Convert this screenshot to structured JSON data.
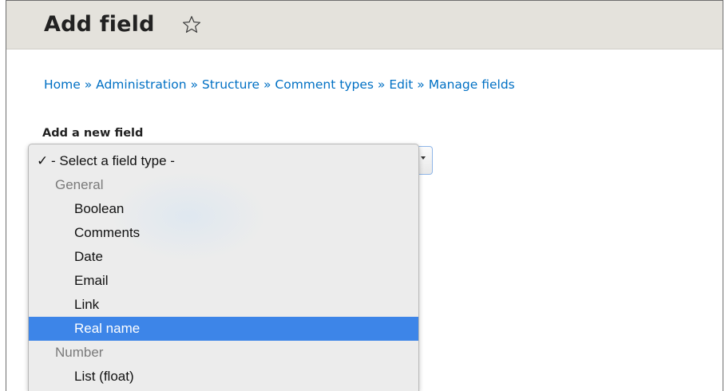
{
  "header": {
    "title": "Add field",
    "star_icon": "star-outline-icon"
  },
  "breadcrumb": {
    "items": [
      "Home",
      "Administration",
      "Structure",
      "Comment types",
      "Edit",
      "Manage fields"
    ],
    "separator": "»"
  },
  "form": {
    "add_field_label": "Add a new field",
    "select": {
      "selected_value": "- Select a field type -",
      "check_mark": "✓",
      "options": [
        {
          "type": "group",
          "label": "General"
        },
        {
          "type": "option",
          "label": "Boolean"
        },
        {
          "type": "option",
          "label": "Comments"
        },
        {
          "type": "option",
          "label": "Date"
        },
        {
          "type": "option",
          "label": "Email"
        },
        {
          "type": "option",
          "label": "Link"
        },
        {
          "type": "option",
          "label": "Real name",
          "highlighted": true
        },
        {
          "type": "group",
          "label": "Number"
        },
        {
          "type": "option",
          "label": "List (float)"
        }
      ]
    }
  },
  "colors": {
    "link": "#0070c4",
    "header_bg": "#e4e2dc",
    "highlight": "#3d85e8"
  }
}
